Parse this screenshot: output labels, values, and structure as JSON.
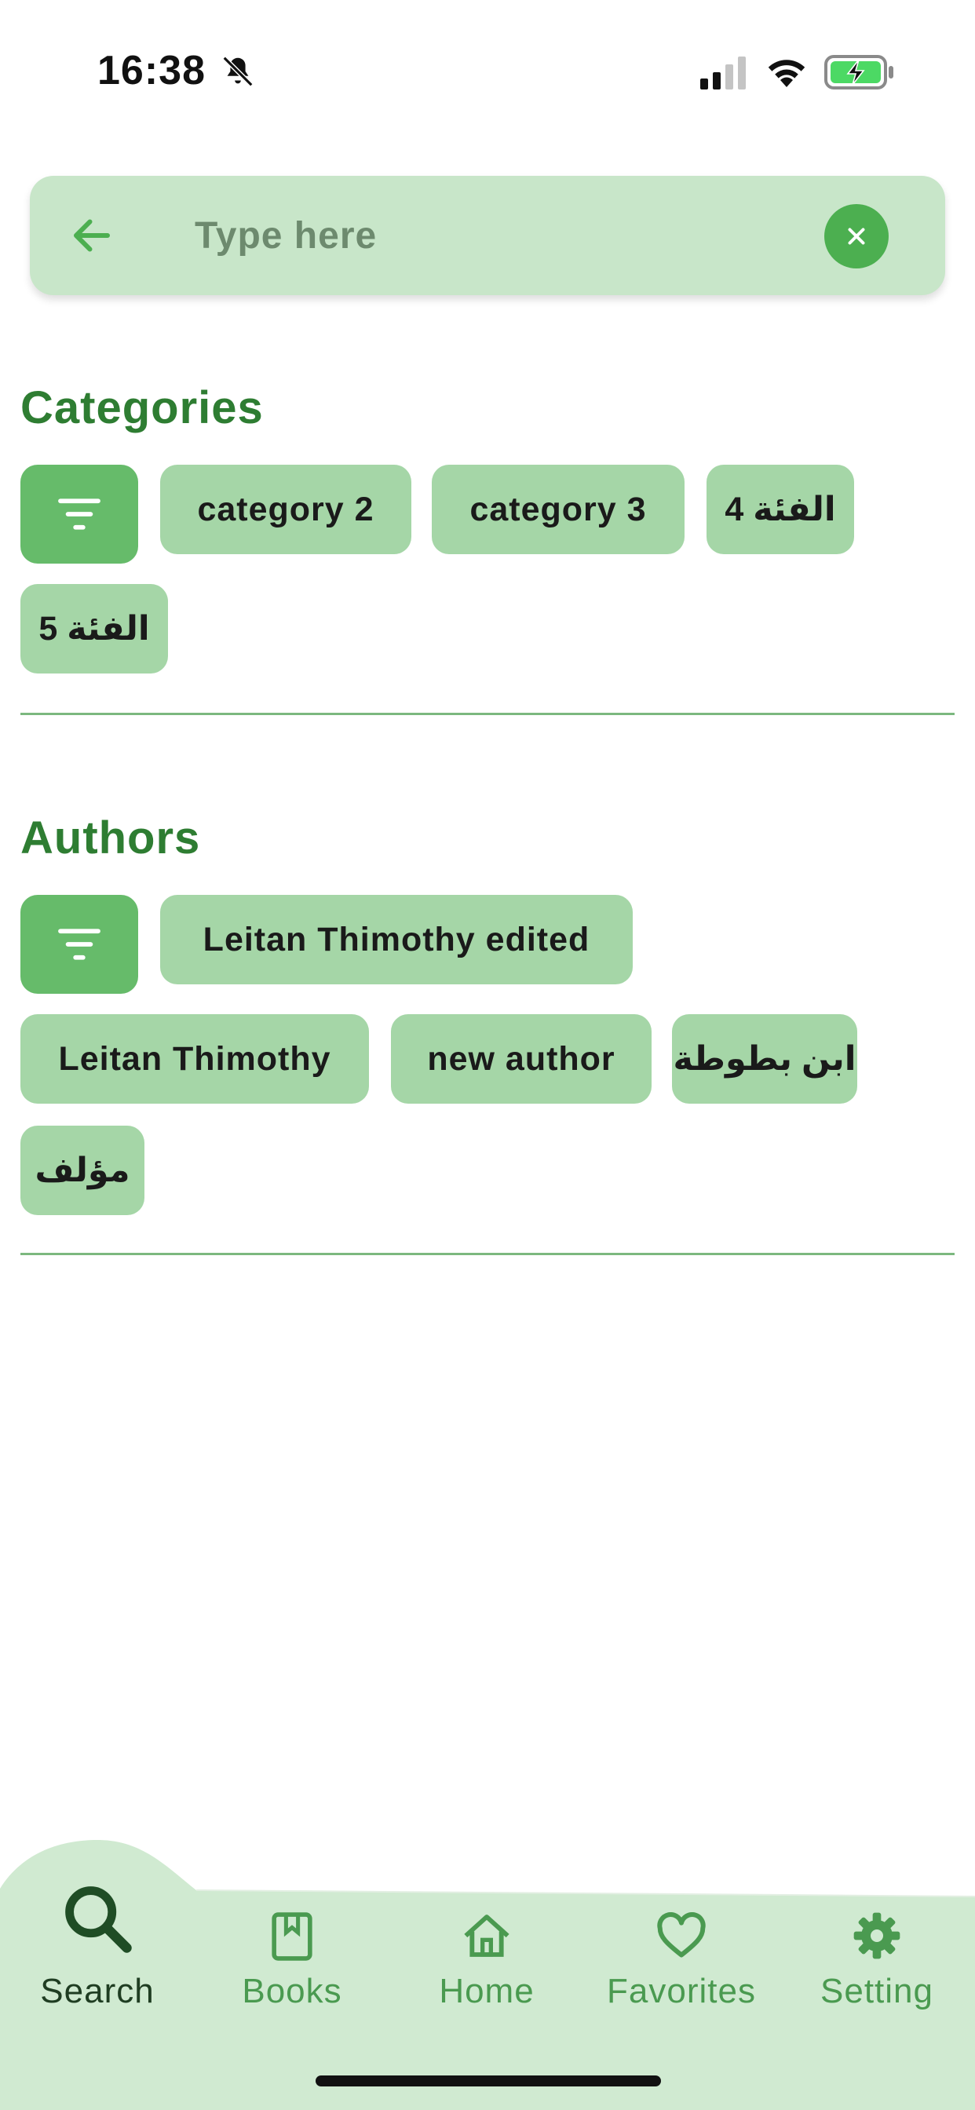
{
  "status_bar": {
    "time": "16:38",
    "icons": [
      "bell-slash-icon",
      "cellular-signal-icon",
      "wifi-icon",
      "battery-charging-icon"
    ]
  },
  "search": {
    "placeholder": "Type here",
    "value": ""
  },
  "categories": {
    "title": "Categories",
    "chips": [
      "category 2",
      "category 3",
      "الفئة 4",
      "الفئة 5"
    ]
  },
  "authors": {
    "title": "Authors",
    "chips": [
      "Leitan Thimothy edited",
      "Leitan Thimothy",
      "new author",
      "ابن بطوطة",
      "مؤلف"
    ]
  },
  "nav": {
    "active": "Search",
    "items": [
      {
        "label": "Search",
        "icon": "search-icon"
      },
      {
        "label": "Books",
        "icon": "book-icon"
      },
      {
        "label": "Home",
        "icon": "home-icon"
      },
      {
        "label": "Favorites",
        "icon": "heart-icon"
      },
      {
        "label": "Setting",
        "icon": "gear-icon"
      }
    ]
  },
  "colors": {
    "primary": "#4caf50",
    "title_green": "#2e7d32",
    "chip": "#a5d6a7",
    "filter_chip": "#66bb6a",
    "search_bg": "#c8e6c9",
    "nav_bg": "#d0ead1",
    "nav_inactive": "#4a9a50",
    "nav_active": "#1f3d22"
  }
}
